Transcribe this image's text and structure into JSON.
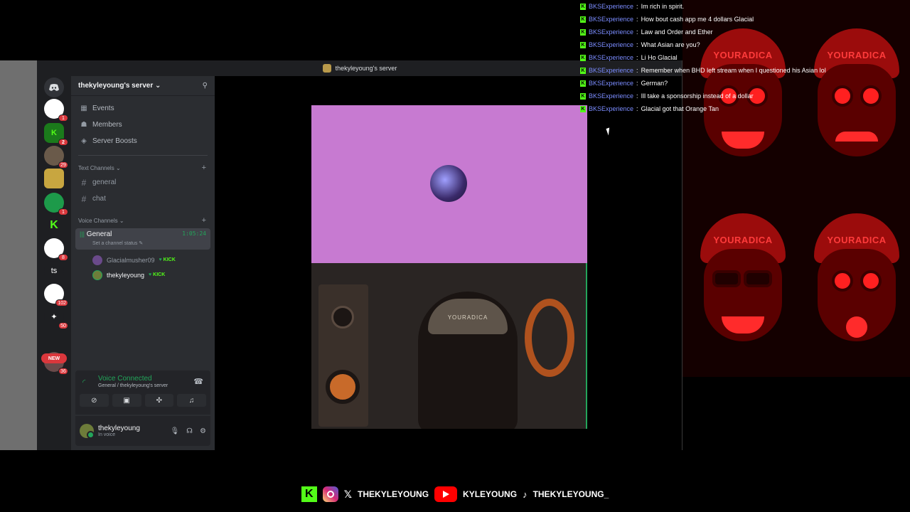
{
  "window": {
    "title": "thekyleyoung's server"
  },
  "server": {
    "name": "thekyleyoung's server",
    "nav": [
      "Events",
      "Members",
      "Server Boosts"
    ],
    "text_category": "Text Channels",
    "text_channels": [
      "general",
      "chat"
    ],
    "voice_category": "Voice Channels",
    "voice_channel": {
      "name": "General",
      "timer": "1:05:24",
      "status": "Set a channel status"
    },
    "voice_users": [
      {
        "name": "Glacialmusher09",
        "badge": "KICK"
      },
      {
        "name": "thekyleyoung",
        "badge": "KICK"
      }
    ]
  },
  "rail": {
    "badges": [
      "1",
      "2",
      "29",
      "",
      "1",
      "",
      "8",
      "",
      "102",
      "50",
      "",
      "36"
    ],
    "ts_label": "ts",
    "new_label": "NEW"
  },
  "voice_panel": {
    "title": "Voice Connected",
    "subtitle": "General / thekyleyoung's server"
  },
  "user_panel": {
    "name": "thekyleyoung",
    "status": "In voice"
  },
  "chat": [
    {
      "user": "BKSExperience",
      "text": "Im rich in spirit."
    },
    {
      "user": "BKSExperience",
      "text": "How bout cash app me 4 dollars Glacial"
    },
    {
      "user": "BKSExperience",
      "text": "Law and Order and Ether"
    },
    {
      "user": "BKSExperience",
      "text": "What Asian are you?"
    },
    {
      "user": "BKSExperience",
      "text": "Li Ho Glacial"
    },
    {
      "user": "BKSExperience",
      "text": "Remember when BHD left stream when I questioned his Asian lol"
    },
    {
      "user": "BKSExperience",
      "text": "German?"
    },
    {
      "user": "BKSExperience",
      "text": "Ill take a sponsorship instead of a dollar"
    },
    {
      "user": "BKSExperience",
      "text": "Glacial got that Orange Tan"
    }
  ],
  "emote_text": "YOURADICA",
  "video": {
    "hat_text": "YOURADICA"
  },
  "social": {
    "x_handle": "THEKYLEYOUNG",
    "yt_handle": "KYLEYOUNG",
    "tt_handle": "THEKYLEYOUNG_"
  },
  "colors": {
    "kick_green": "#53fc18",
    "discord_green": "#23a55a",
    "tile_purple": "#c77ad1",
    "chat_user": "#7b8cff"
  }
}
